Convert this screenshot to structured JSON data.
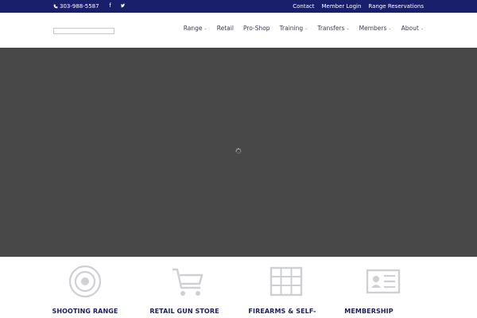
{
  "topbar": {
    "phone": "303-988-5587",
    "social": {
      "facebook": "f",
      "twitter": "t"
    },
    "links": [
      "Contact",
      "Member Login",
      "Range Reservations"
    ]
  },
  "header": {
    "nav": [
      {
        "label": "Range",
        "dropdown": true
      },
      {
        "label": "Retail",
        "dropdown": false
      },
      {
        "label": "Pro-Shop",
        "dropdown": false
      },
      {
        "label": "Training",
        "dropdown": true
      },
      {
        "label": "Transfers",
        "dropdown": true
      },
      {
        "label": "Members",
        "dropdown": true
      },
      {
        "label": "About",
        "dropdown": true
      }
    ]
  },
  "features": [
    {
      "title": "SHOOTING RANGE",
      "icon": "target-icon"
    },
    {
      "title": "RETAIL GUN STORE",
      "icon": "cart-icon"
    },
    {
      "title": "FIREARMS & SELF-",
      "icon": "calendar-grid-icon"
    },
    {
      "title": "MEMBERSHIP",
      "icon": "id-card-icon"
    }
  ],
  "colors": {
    "topbar": "#1a1f6b",
    "hero": "#484848",
    "feature_title": "#1a1f5a",
    "icon": "#cfd0d6"
  }
}
